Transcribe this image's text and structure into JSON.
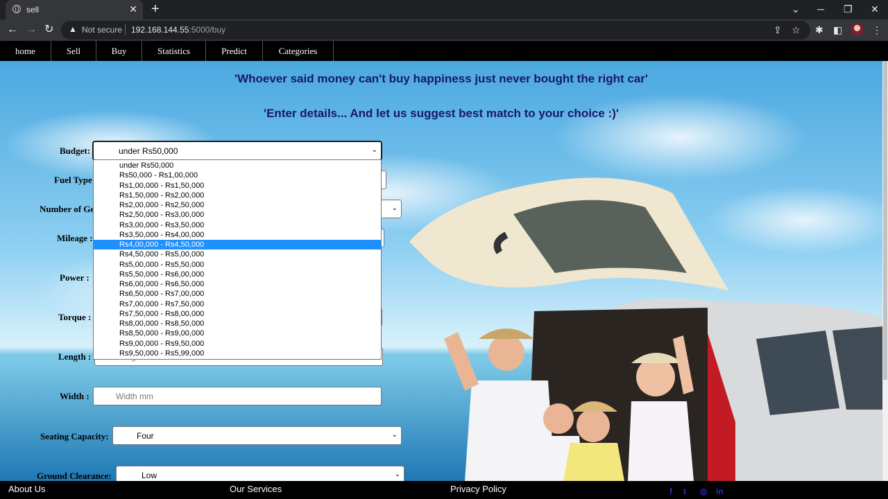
{
  "browser": {
    "tab_title": "sell",
    "url_warning": "Not secure",
    "url_host": "192.168.144.55",
    "url_path": ":5000/buy"
  },
  "nav": {
    "items": [
      "home",
      "Sell",
      "Buy",
      "Statistics",
      "Predict",
      "Categories"
    ]
  },
  "quotes": [
    "'Whoever said money can't buy happiness just never bought the right car'",
    "'Enter details... And let us suggest best match to your choice :)'"
  ],
  "form": {
    "budget": {
      "label": "Budget:",
      "value": "under Rs50,000"
    },
    "fuel_type": {
      "label": "Fuel Type"
    },
    "gears": {
      "label": "Number of Ge"
    },
    "mileage": {
      "label": "Mileage :"
    },
    "power": {
      "label": "Power :"
    },
    "torque": {
      "label": "Torque :"
    },
    "length": {
      "label": "Length :",
      "placeholder": "Length mm"
    },
    "width": {
      "label": "Width :",
      "placeholder": "Width mm"
    },
    "seating": {
      "label": "Seating Capacity:",
      "value": "Four"
    },
    "clearance": {
      "label": "Ground Clearance:",
      "value": "Low"
    }
  },
  "budget_options": [
    "under Rs50,000",
    "Rs50,000 - Rs1,00,000",
    "Rs1,00,000 - Rs1,50,000",
    "Rs1,50,000 - Rs2,00,000",
    "Rs2,00,000 - Rs2,50,000",
    "Rs2,50,000 - Rs3,00,000",
    "Rs3,00,000 - Rs3,50,000",
    "Rs3,50,000 - Rs4,00,000",
    "Rs4,00,000 - Rs4,50,000",
    "Rs4,50,000 - Rs5,00,000",
    "Rs5,00,000 - Rs5,50,000",
    "Rs5,50,000 - Rs6,00,000",
    "Rs6,00,000 - Rs6,50,000",
    "Rs6,50,000 - Rs7,00,000",
    "Rs7,00,000 - Rs7,50,000",
    "Rs7,50,000 - Rs8,00,000",
    "Rs8,00,000 - Rs8,50,000",
    "Rs8,50,000 - Rs9,00,000",
    "Rs9,00,000 - Rs9,50,000",
    "Rs9,50,000 - Rs5,99,000"
  ],
  "budget_highlighted": "Rs4,00,000 - Rs4,50,000",
  "footer": {
    "about": "About Us",
    "services": "Our Services",
    "privacy": "Privacy Policy",
    "social": [
      "facebook-icon",
      "twitter-icon",
      "instagram-icon",
      "linkedin-icon"
    ]
  },
  "colors": {
    "accent": "#1e90ff",
    "quote": "#18186a",
    "nav_bg": "#000000"
  }
}
